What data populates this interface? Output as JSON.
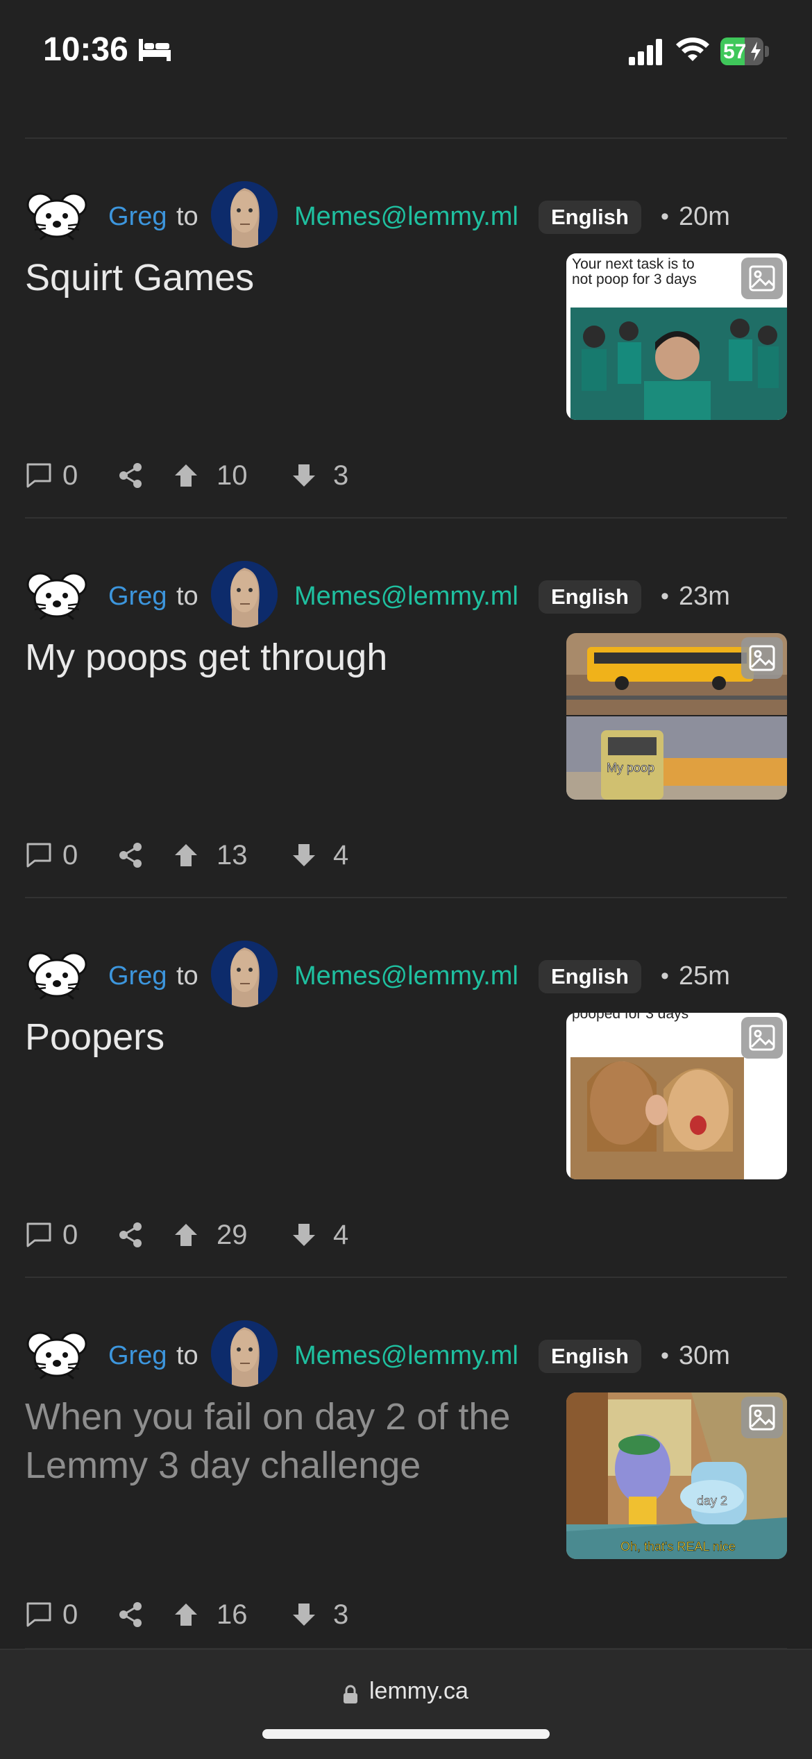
{
  "status_bar": {
    "time": "10:36",
    "battery": "57",
    "battery_level": 0.57
  },
  "posts": [
    {
      "user": "Greg",
      "to": "to",
      "community": "Memes@lemmy.ml",
      "language": "English",
      "dot": "•",
      "time": "20m",
      "title": "Squirt Games",
      "read": false,
      "comments": "0",
      "upvotes": "10",
      "downvotes": "3",
      "thumb_caption": "Your next task is to not poop for 3 days"
    },
    {
      "user": "Greg",
      "to": "to",
      "community": "Memes@lemmy.ml",
      "language": "English",
      "dot": "•",
      "time": "23m",
      "title": "My poops get through",
      "read": false,
      "comments": "0",
      "upvotes": "13",
      "downvotes": "4",
      "thumb_caption": "My poop"
    },
    {
      "user": "Greg",
      "to": "to",
      "community": "Memes@lemmy.ml",
      "language": "English",
      "dot": "•",
      "time": "25m",
      "title": "Poopers",
      "read": false,
      "comments": "0",
      "upvotes": "29",
      "downvotes": "4",
      "thumb_caption": "pooped for 3 days"
    },
    {
      "user": "Greg",
      "to": "to",
      "community": "Memes@lemmy.ml",
      "language": "English",
      "dot": "•",
      "time": "30m",
      "title": "When you fail on day 2 of the Lemmy 3 day challenge",
      "read": true,
      "comments": "0",
      "upvotes": "16",
      "downvotes": "3",
      "thumb_caption": "day 2",
      "thumb_caption2": "Oh, that's REAL nice"
    }
  ],
  "browser": {
    "url": "lemmy.ca"
  },
  "icons": {
    "status": [
      "bed-icon",
      "signal-icon",
      "wifi-icon",
      "battery-icon"
    ],
    "post": [
      "rat-avatar-icon",
      "community-avatar",
      "image-icon",
      "comment-icon",
      "share-icon",
      "upvote-icon",
      "downvote-icon"
    ],
    "browser": [
      "lock-icon"
    ]
  },
  "colors": {
    "background": "#222222",
    "username": "#3d96dd",
    "community": "#1fc0a0",
    "battery": "#3fc75a"
  }
}
